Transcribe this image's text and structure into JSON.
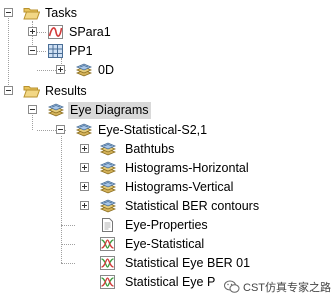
{
  "tree": {
    "tasks": {
      "label": "Tasks"
    },
    "spara1": {
      "label": "SPara1"
    },
    "pp1": {
      "label": "PP1"
    },
    "od": {
      "label": "0D"
    },
    "results": {
      "label": "Results"
    },
    "eye_diagrams": {
      "label": "Eye Diagrams"
    },
    "eye_statistical_s21": {
      "label": "Eye-Statistical-S2,1"
    },
    "bathtubs": {
      "label": "Bathtubs"
    },
    "hist_horizontal": {
      "label": "Histograms-Horizontal"
    },
    "hist_vertical": {
      "label": "Histograms-Vertical"
    },
    "ber_contours": {
      "label": "Statistical BER contours"
    },
    "eye_properties": {
      "label": "Eye-Properties"
    },
    "eye_statistical": {
      "label": "Eye-Statistical"
    },
    "stat_eye_ber01": {
      "label": "Statistical Eye BER 01"
    },
    "stat_eye_p": {
      "label": "Statistical Eye P"
    }
  },
  "watermark": {
    "text": "CST仿真专家之路"
  },
  "colors": {
    "selection": "#d9d9d9",
    "folder": "#e8c35a",
    "curve": "#d23a3a"
  }
}
